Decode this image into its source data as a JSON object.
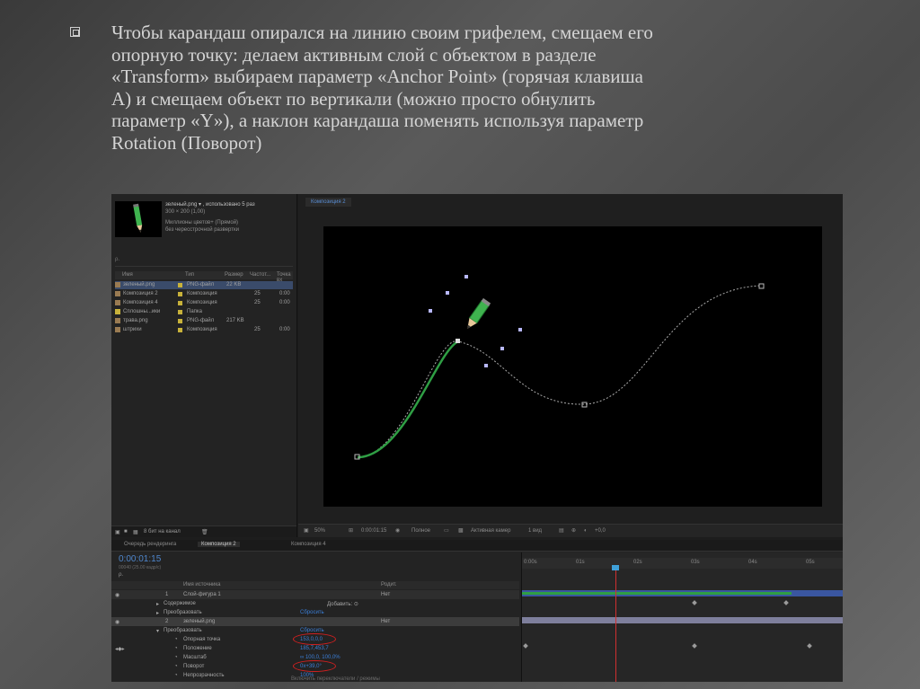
{
  "slide": {
    "lines": [
      "Чтобы карандаш опирался на линию своим грифелем, смещаем его",
      "опорную точку: делаем активным слой с объектом в разделе",
      "«Transform» выбираем параметр «Anchor Point» (горячая клавиша",
      "A) и смещаем объект по вертикали (можно просто обнулить",
      "параметр «Y»), а наклон карандаша поменять используя параметр",
      "Rotation (Поворот)"
    ]
  },
  "project": {
    "file_name": "зеленый.png ▾ , использовано 5 раз",
    "dims": "300 × 200 (1,00)",
    "info1": "Миллионы цветов+ (Прямой)",
    "info2": "без чересстрочной развертки",
    "search": "ρ.",
    "columns": [
      "Имя",
      "Тип",
      "Размер",
      "Частот...",
      "Точка вх"
    ],
    "items": [
      {
        "name": "зеленый.png",
        "type": "PNG-файл",
        "size": "22 KB",
        "fps": "",
        "inpoint": ""
      },
      {
        "name": "Композиция 2",
        "type": "Композиция",
        "size": "",
        "fps": "25",
        "inpoint": "0:00"
      },
      {
        "name": "Композиция 4",
        "type": "Композиция",
        "size": "",
        "fps": "25",
        "inpoint": "0:00"
      },
      {
        "name": "Сплошны...ики",
        "type": "Папка",
        "size": "",
        "fps": "",
        "inpoint": ""
      },
      {
        "name": "трава.png",
        "type": "PNG-файл",
        "size": "217 KB",
        "fps": "",
        "inpoint": ""
      },
      {
        "name": "штрихи",
        "type": "Композиция",
        "size": "",
        "fps": "25",
        "inpoint": "0:00"
      }
    ],
    "footer": "8 бит на канал"
  },
  "composition": {
    "tab": "Композиция 2",
    "zoom": "50%",
    "timecode": "0:00:01:15",
    "quality": "Полное",
    "camera": "Активная камер",
    "views": "1 вид",
    "offset": "+0,0"
  },
  "timeline": {
    "tabs": [
      "Очередь рендеринга",
      "Композиция 2",
      "Композиция 4"
    ],
    "time": "0:00:01:15",
    "time_sub": "00040 (25.00 кадр/с)",
    "search": "ρ.",
    "header_name": "Имя источника",
    "header_parent": "Родит.",
    "rows": [
      {
        "num": "1",
        "name": "Слой-фигура 1",
        "parent": "Нет",
        "kind": "layer"
      },
      {
        "num": "",
        "name": "Содержимое",
        "value": "Добавить: ⊙",
        "kind": "group"
      },
      {
        "num": "",
        "name": "Преобразовать",
        "value": "Сбросить",
        "kind": "group"
      },
      {
        "num": "2",
        "name": "зеленый.png",
        "parent": "Нет",
        "kind": "layer-sel"
      },
      {
        "num": "",
        "name": "Преобразовать",
        "value": "Сбросить",
        "kind": "group"
      },
      {
        "num": "",
        "name": "Опорная точка",
        "value": "153,0,0,0",
        "kind": "prop"
      },
      {
        "num": "",
        "name": "Положение",
        "value": "185,7,453,7",
        "kind": "prop"
      },
      {
        "num": "",
        "name": "Масштаб",
        "value": "∞ 100,0, 100,0%",
        "kind": "prop"
      },
      {
        "num": "",
        "name": "Поворот",
        "value": "0x+39,0°",
        "kind": "prop"
      },
      {
        "num": "",
        "name": "Непрозрачность",
        "value": "100%",
        "kind": "prop"
      }
    ],
    "ruler": [
      "0:00s",
      "01s",
      "02s",
      "03s",
      "04s",
      "05s"
    ],
    "footer": "Включить переключатели / режимы"
  },
  "colors": {
    "accent": "#3b7fd8",
    "highlight": "#d02020",
    "path": "#2f9e44"
  }
}
